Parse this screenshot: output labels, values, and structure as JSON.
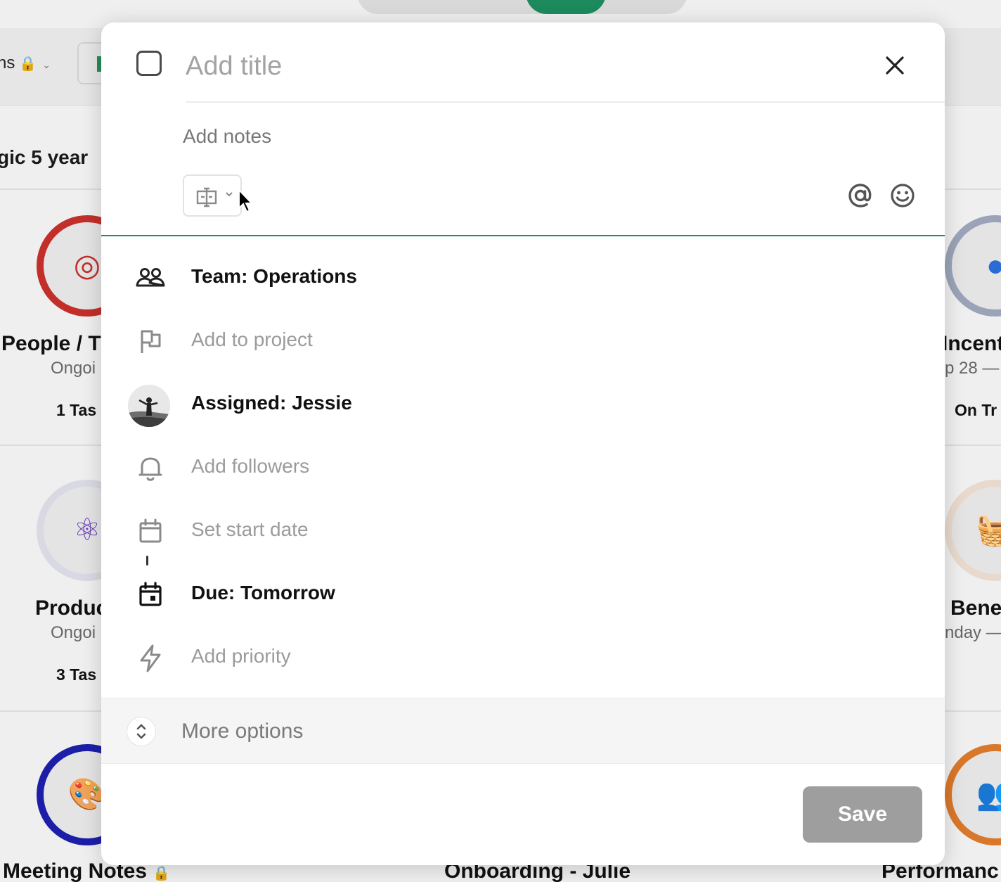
{
  "background": {
    "breadcrumb_fragment": "ns",
    "heading_fragment": "gic 5 year",
    "cards": [
      {
        "label": "People / T",
        "sub": "Ongoi",
        "tasks": "1 Tas",
        "icon": "target-icon",
        "ring_color": "#c22f2a"
      },
      {
        "label": "Incent",
        "sub": "p 28 —",
        "tasks": "On Tr",
        "icon": "chat-bubbles-icon",
        "ring_color": "#9aa3b8"
      },
      {
        "label": "Produc",
        "sub": "Ongoi",
        "tasks": "3 Tas",
        "icon": "atom-icon",
        "ring_color": "#d9d9e3"
      },
      {
        "label": "Bene",
        "sub": "nday —",
        "tasks": "",
        "icon": "basket-icon",
        "ring_color": "#e8d9cc"
      },
      {
        "label": "Meeting Notes",
        "sub": "",
        "tasks": "",
        "icon": "palette-icon",
        "ring_color": "#1c1ea8"
      },
      {
        "label": "Onboarding - Julie",
        "sub": "",
        "tasks": "",
        "icon": "",
        "ring_color": ""
      },
      {
        "label": "Performanc",
        "sub": "",
        "tasks": "",
        "icon": "people-icon",
        "ring_color": "#d9772a"
      }
    ]
  },
  "modal": {
    "title_placeholder": "Add title",
    "notes_placeholder": "Add notes",
    "fields": {
      "team": "Team: Operations",
      "project": "Add to project",
      "assigned": "Assigned: Jessie",
      "followers": "Add followers",
      "start_date": "Set start date",
      "due": "Due: Tomorrow",
      "priority": "Add priority"
    },
    "more_options": "More options",
    "save_label": "Save",
    "accent_color": "#2b8a63"
  }
}
